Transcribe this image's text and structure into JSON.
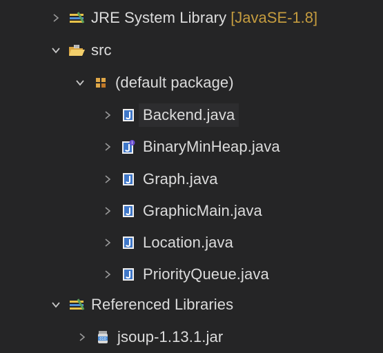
{
  "tree": {
    "items": [
      {
        "label": "JRE System Library",
        "decoration": "[JavaSE-1.8]",
        "icon": "library-icon",
        "expanded": false
      },
      {
        "label": "src",
        "icon": "source-folder-icon",
        "expanded": true
      },
      {
        "label": "(default package)",
        "icon": "package-icon",
        "expanded": true
      },
      {
        "label": "Backend.java",
        "icon": "java-file-icon",
        "expanded": false
      },
      {
        "label": "BinaryMinHeap.java",
        "icon": "java-interface-file-icon",
        "expanded": false
      },
      {
        "label": "Graph.java",
        "icon": "java-file-icon",
        "expanded": false
      },
      {
        "label": "GraphicMain.java",
        "icon": "java-file-icon",
        "expanded": false
      },
      {
        "label": "Location.java",
        "icon": "java-file-icon",
        "expanded": false
      },
      {
        "label": "PriorityQueue.java",
        "icon": "java-file-icon",
        "expanded": false
      },
      {
        "label": "Referenced Libraries",
        "icon": "library-icon",
        "expanded": true
      },
      {
        "label": "jsoup-1.13.1.jar",
        "icon": "jar-icon",
        "expanded": false
      }
    ]
  },
  "colors": {
    "background": "#252526",
    "text": "#dcdcdc",
    "decoration": "#c59c3f",
    "chevron": "#9a9a9a"
  }
}
